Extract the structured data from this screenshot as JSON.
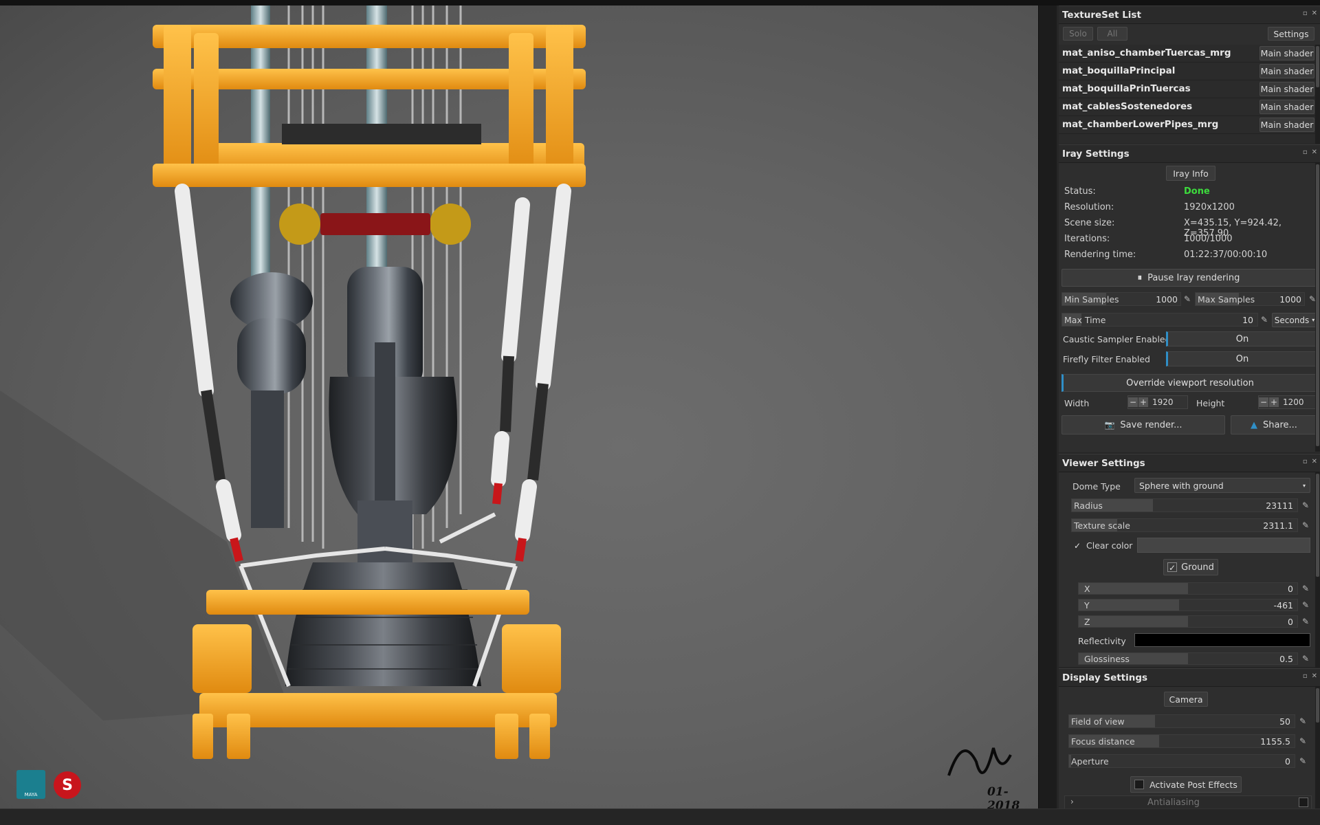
{
  "textureset": {
    "title": "TextureSet List",
    "solo_label": "Solo",
    "all_label": "All",
    "settings_label": "Settings",
    "materials": [
      {
        "name": "mat_aniso_chamberTuercas_mrg",
        "shader": "Main shader"
      },
      {
        "name": "mat_boquillaPrincipal",
        "shader": "Main shader"
      },
      {
        "name": "mat_boquillaPrinTuercas",
        "shader": "Main shader"
      },
      {
        "name": "mat_cablesSostenedores",
        "shader": "Main shader"
      },
      {
        "name": "mat_chamberLowerPipes_mrg",
        "shader": "Main shader"
      }
    ]
  },
  "iray": {
    "title": "Iray Settings",
    "info_button": "Iray Info",
    "status_label": "Status:",
    "status_value": "Done",
    "resolution_label": "Resolution:",
    "resolution_value": "1920x1200",
    "scene_label": "Scene size:",
    "scene_value": "X=435.15, Y=924.42, Z=357.90",
    "iterations_label": "Iterations:",
    "iterations_value": "1000/1000",
    "time_label": "Rendering time:",
    "time_value": "01:22:37/00:00:10",
    "pause_label": "Pause Iray rendering",
    "min_samples_label": "Min Samples",
    "min_samples_value": "1000",
    "max_samples_label": "Max Samples",
    "max_samples_value": "1000",
    "max_time_label": "Max Time",
    "max_time_value": "10",
    "time_unit": "Seconds",
    "caustic_label": "Caustic Sampler Enabled",
    "caustic_value": "On",
    "firefly_label": "Firefly Filter Enabled",
    "firefly_value": "On",
    "override_label": "Override viewport resolution",
    "width_label": "Width",
    "width_value": "1920",
    "height_label": "Height",
    "height_value": "1200",
    "save_label": "Save render...",
    "share_label": "Share..."
  },
  "viewer": {
    "title": "Viewer Settings",
    "dome_label": "Dome Type",
    "dome_value": "Sphere with ground",
    "radius_label": "Radius",
    "radius_value": "23111",
    "texscale_label": "Texture scale",
    "texscale_value": "2311.1",
    "clear_color_label": "Clear color",
    "ground_label": "Ground",
    "x_label": "X",
    "x_value": "0",
    "y_label": "Y",
    "y_value": "-461",
    "z_label": "Z",
    "z_value": "0",
    "reflectivity_label": "Reflectivity",
    "glossiness_label": "Glossiness",
    "glossiness_value": "0.5"
  },
  "display": {
    "title": "Display Settings",
    "camera_label": "Camera",
    "fov_label": "Field of view",
    "fov_value": "50",
    "focus_label": "Focus distance",
    "focus_value": "1155.5",
    "aperture_label": "Aperture",
    "aperture_value": "0",
    "post_effects_label": "Activate Post Effects",
    "antialiasing_label": "Antialiasing"
  },
  "viewport": {
    "signature_date": "01-2018",
    "maya_label": "MAYA"
  },
  "colors": {
    "accent": "#2f8fc7",
    "status_done": "#3ddc3d",
    "frame_orange": "#f2a623"
  },
  "icons": [
    "pause-icon",
    "pen-icon",
    "camera-icon",
    "share-icon",
    "check-icon",
    "chevron-right-icon",
    "dropdown-arrow-icon"
  ]
}
